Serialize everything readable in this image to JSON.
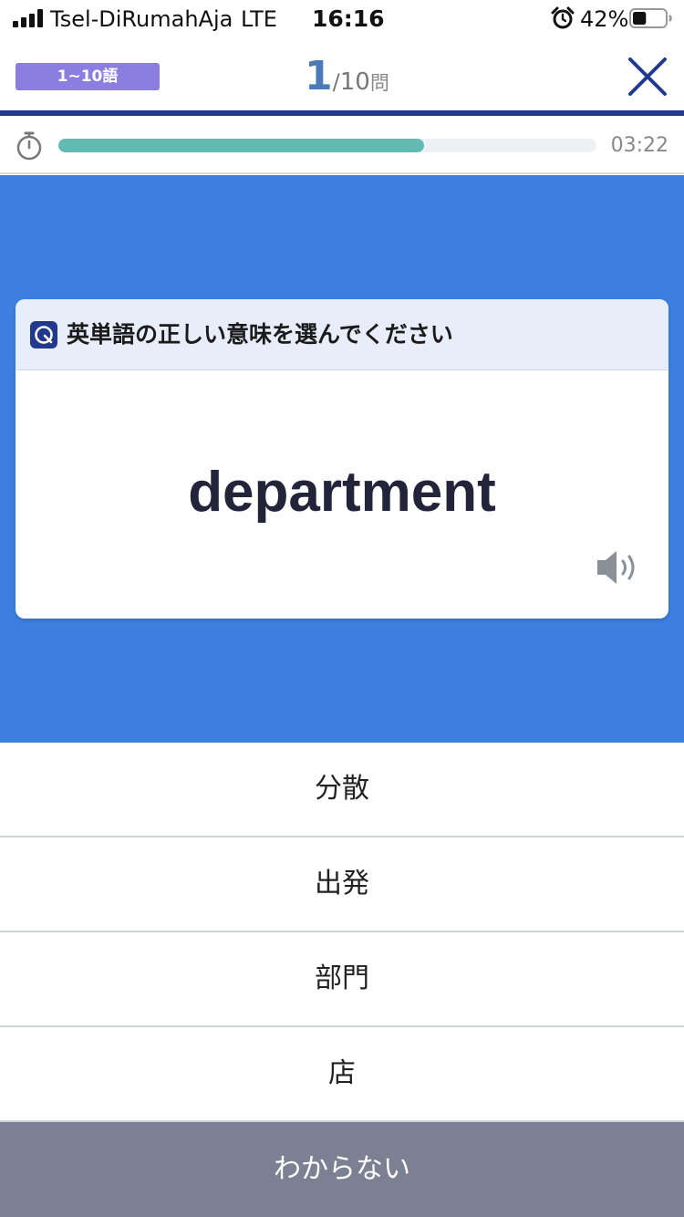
{
  "status_bar": {
    "carrier": "Tsel-DiRumahAja",
    "network": "LTE",
    "time": "16:16",
    "battery_percent": "42%",
    "battery_level": 0.42,
    "signal_bars": 4
  },
  "header": {
    "range_badge": "1~10語",
    "counter_current": "1",
    "counter_separator": "/",
    "counter_total": "10",
    "counter_unit": "問",
    "close_icon": "close-icon"
  },
  "timer": {
    "progress": 0.68,
    "remaining": "03:22",
    "icon": "stopwatch-icon"
  },
  "question": {
    "prompt": "英単語の正しい意味を選んでください",
    "word": "department",
    "speaker_icon": "speaker-icon"
  },
  "answers": [
    "分散",
    "出発",
    "部門",
    "店"
  ],
  "dont_know_label": "わからない",
  "colors": {
    "badge": "#8c7de0",
    "counter_accent": "#4a7ab8",
    "header_rule": "#213a8f",
    "progress_fill": "#62bbb2",
    "question_bg": "#3d7fdf",
    "card_header_bg": "#e7eef9",
    "word_text": "#22253a",
    "dont_know_bg": "#7b8093"
  }
}
